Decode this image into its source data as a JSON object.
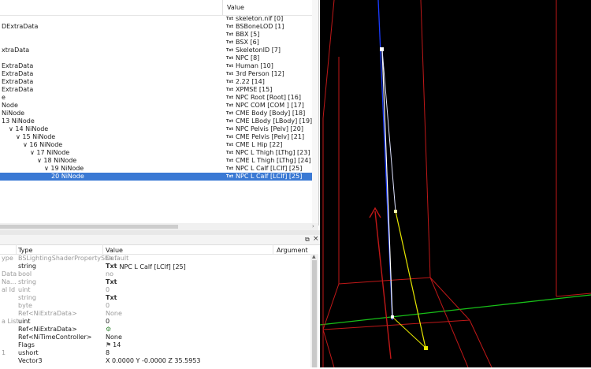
{
  "tree": {
    "value_header": "Value",
    "rows": [
      {
        "name": "",
        "value": "skeleton.nif [0]",
        "indent": 0
      },
      {
        "name": "DExtraData",
        "value": "BSBoneLOD [1]",
        "indent": 0
      },
      {
        "name": "",
        "value": "BBX [5]",
        "indent": 0
      },
      {
        "name": "",
        "value": "BSX [6]",
        "indent": 0
      },
      {
        "name": "xtraData",
        "value": "SkeletonID [7]",
        "indent": 0
      },
      {
        "name": "",
        "value": "NPC [8]",
        "indent": 0
      },
      {
        "name": "ExtraData",
        "value": "Human [10]",
        "indent": 0
      },
      {
        "name": "ExtraData",
        "value": "3rd Person [12]",
        "indent": 0
      },
      {
        "name": "ExtraData",
        "value": "2.22 [14]",
        "indent": 0
      },
      {
        "name": "ExtraData",
        "value": "XPMSE [15]",
        "indent": 0
      },
      {
        "name": "e",
        "value": "NPC Root [Root] [16]",
        "indent": 0
      },
      {
        "name": "Node",
        "value": "NPC COM [COM ] [17]",
        "indent": 0
      },
      {
        "name": "NiNode",
        "value": "CME Body [Body] [18]",
        "indent": 0
      },
      {
        "name": "13 NiNode",
        "value": "CME LBody [LBody] [19]",
        "indent": 0
      },
      {
        "name": "∨ 14 NiNode",
        "value": "NPC Pelvis [Pelv] [20]",
        "indent": 1
      },
      {
        "name": "∨ 15 NiNode",
        "value": "CME Pelvis [Pelv] [21]",
        "indent": 2
      },
      {
        "name": "∨ 16 NiNode",
        "value": "CME L Hip [22]",
        "indent": 3
      },
      {
        "name": "∨ 17 NiNode",
        "value": "NPC L Thigh [LThg] [23]",
        "indent": 4
      },
      {
        "name": "∨ 18 NiNode",
        "value": "CME L Thigh [LThg] [24]",
        "indent": 5
      },
      {
        "name": "∨ 19 NiNode",
        "value": "NPC L Calf [LClf] [25]",
        "indent": 6
      },
      {
        "name": "20 NiNode",
        "value": "NPC L Calf [LClf] [25]",
        "indent": 7,
        "selected": true
      }
    ]
  },
  "props": {
    "headers": {
      "name": "",
      "type": "Type",
      "value": "Value",
      "argument": "Argument"
    },
    "rows": [
      {
        "name": "ype",
        "type": "BSLightingShaderPropertySha...",
        "value": "Default",
        "dim": true
      },
      {
        "name": "",
        "type": "string",
        "value": "NPC L Calf [LClf] [25]",
        "tt": true,
        "dim": false
      },
      {
        "name": "Data",
        "type": "bool",
        "value": "no",
        "dim": true
      },
      {
        "name": "Na...",
        "type": "string",
        "value": "",
        "tt": true,
        "dim": true
      },
      {
        "name": "al Id",
        "type": "uint",
        "value": "0",
        "dim": true
      },
      {
        "name": "",
        "type": "string",
        "value": "",
        "tt": true,
        "dim": true
      },
      {
        "name": "",
        "type": "byte",
        "value": "0",
        "dim": true
      },
      {
        "name": "",
        "type": "Ref<NiExtraData>",
        "value": "None",
        "dim": true
      },
      {
        "name": "a List",
        "type": "uint",
        "value": "0",
        "dim": false
      },
      {
        "name": "",
        "type": "Ref<NiExtraData>",
        "value": "",
        "icon": "gear",
        "dim": false
      },
      {
        "name": "",
        "type": "Ref<NiTimeController>",
        "value": "None",
        "dim": false
      },
      {
        "name": "",
        "type": "Flags",
        "value": "14",
        "icon": "flags",
        "dim": false
      },
      {
        "name": "1",
        "type": "ushort",
        "value": "8",
        "dim": false
      },
      {
        "name": "",
        "type": "Vector3",
        "value": "X 0.0000 Y -0.0000 Z 35.5953",
        "dim": false
      }
    ]
  },
  "icons": {
    "text_type": "Txt",
    "gear": "gear-icon",
    "flags": "flags-icon",
    "float": "⧉",
    "close": "×"
  },
  "colors": {
    "selection": "#3a79d4",
    "viewport_bg": "#000000",
    "bone_main": "#f0f0ff",
    "bone_child": "#e6e600",
    "box": "#c01818",
    "axis_y": "#1a3cff",
    "axis_x": "#18c018"
  }
}
